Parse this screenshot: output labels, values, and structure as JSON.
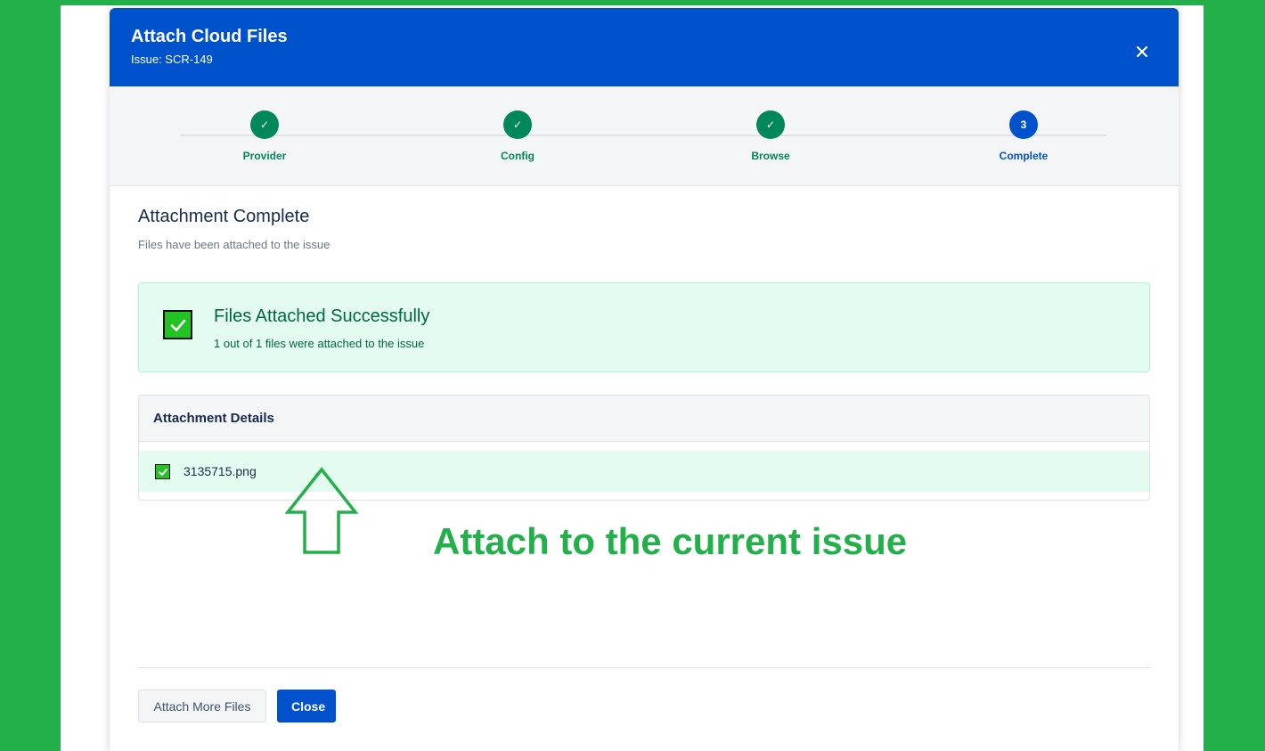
{
  "modal": {
    "title": "Attach Cloud Files",
    "subtitle": "Issue: SCR-149",
    "close_icon": "close-icon"
  },
  "steps": [
    {
      "label": "Provider",
      "state": "done",
      "marker": "✓"
    },
    {
      "label": "Config",
      "state": "done",
      "marker": "✓"
    },
    {
      "label": "Browse",
      "state": "done",
      "marker": "✓"
    },
    {
      "label": "Complete",
      "state": "current",
      "marker": "3"
    }
  ],
  "content": {
    "title": "Attachment Complete",
    "subtitle": "Files have been attached to the issue"
  },
  "success": {
    "icon": "check-box-icon",
    "title": "Files Attached Successfully",
    "text": "1 out of 1 files were attached to the issue"
  },
  "details": {
    "header": "Attachment Details",
    "files": [
      {
        "name": "3135715.png",
        "icon": "check-box-icon"
      }
    ]
  },
  "annotation": {
    "text": "Attach to the current issue",
    "arrow_icon": "up-arrow-icon"
  },
  "footer": {
    "attach_more_label": "Attach More Files",
    "close_label": "Close"
  },
  "colors": {
    "brand": "#0052cc",
    "success": "#00875a",
    "success_bg": "#e3fcef",
    "annotation": "#23b04a"
  }
}
